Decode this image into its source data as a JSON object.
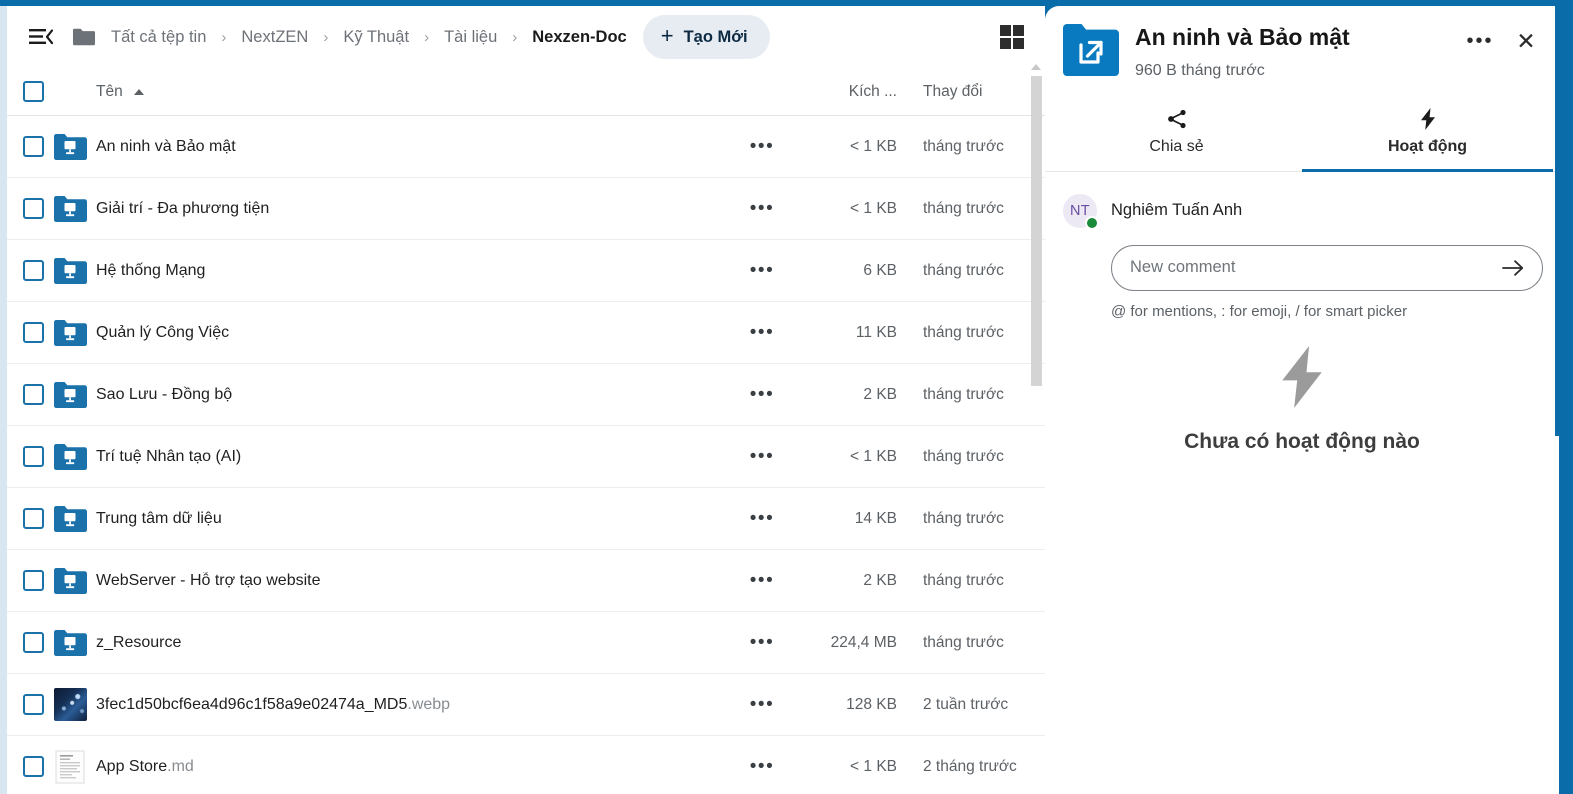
{
  "theme": {
    "accent_blue": "#0a6ca8",
    "folder_blue": "#1b72ab",
    "pill_bg": "#e7ecf2",
    "muted_text": "#5c6166",
    "online_green": "#1a8a3a",
    "avatar_purple": "#6a4fa3"
  },
  "topbar": {
    "menu_icon": "hamburger-collapse-icon",
    "folder_icon": "folder-icon",
    "breadcrumbs": [
      {
        "label": "Tất cả tệp tin",
        "current": false
      },
      {
        "label": "NextZEN",
        "current": false
      },
      {
        "label": "Kỹ Thuật",
        "current": false
      },
      {
        "label": "Tài liệu",
        "current": false
      },
      {
        "label": "Nexzen-Doc",
        "current": true
      }
    ],
    "separator": "›",
    "new_button": {
      "label": "Tạo Mới",
      "icon": "plus-icon"
    },
    "view_toggle_icon": "grid-view-icon"
  },
  "table": {
    "select_all_checkbox": "",
    "columns": {
      "name": "Tên",
      "name_sort_icon": "sort-ascending-icon",
      "size": "Kích ...",
      "modified": "Thay đổi"
    },
    "actions_glyph": "•••",
    "rows": [
      {
        "name": "An ninh và Bảo mật",
        "ext": "",
        "icon": "folder-external-icon",
        "size": "< 1 KB",
        "modified": "tháng trước"
      },
      {
        "name": "Giải trí - Đa phương tiện",
        "ext": "",
        "icon": "folder-external-icon",
        "size": "< 1 KB",
        "modified": "tháng trước"
      },
      {
        "name": "Hệ thống Mạng",
        "ext": "",
        "icon": "folder-external-icon",
        "size": "6 KB",
        "modified": "tháng trước"
      },
      {
        "name": "Quản lý Công Việc",
        "ext": "",
        "icon": "folder-external-icon",
        "size": "11 KB",
        "modified": "tháng trước"
      },
      {
        "name": "Sao Lưu - Đồng bộ",
        "ext": "",
        "icon": "folder-external-icon",
        "size": "2 KB",
        "modified": "tháng trước"
      },
      {
        "name": "Trí tuệ Nhân tạo (AI)",
        "ext": "",
        "icon": "folder-external-icon",
        "size": "< 1 KB",
        "modified": "tháng trước"
      },
      {
        "name": "Trung tâm dữ liệu",
        "ext": "",
        "icon": "folder-external-icon",
        "size": "14 KB",
        "modified": "tháng trước"
      },
      {
        "name": "WebServer - Hỗ trợ tạo website",
        "ext": "",
        "icon": "folder-external-icon",
        "size": "2 KB",
        "modified": "tháng trước"
      },
      {
        "name": "z_Resource",
        "ext": "",
        "icon": "folder-external-icon",
        "size": "224,4 MB",
        "modified": "tháng trước"
      },
      {
        "name": "3fec1d50bcf6ea4d96c1f58a9e02474a_MD5",
        "ext": ".webp",
        "icon": "image-thumbnail",
        "size": "128 KB",
        "modified": "2 tuần trước"
      },
      {
        "name": "App Store",
        "ext": ".md",
        "icon": "markdown-file-icon",
        "size": "< 1 KB",
        "modified": "2 tháng trước"
      }
    ]
  },
  "details": {
    "file_icon": "folder-external-link-icon",
    "title": "An ninh và Bảo mật",
    "subtitle": "960 B tháng trước",
    "menu_glyph": "•••",
    "close_glyph": "✕",
    "tabs": [
      {
        "label": "Chia sẻ",
        "icon": "share-icon",
        "active": false
      },
      {
        "label": "Hoạt động",
        "icon": "lightning-bolt-icon",
        "active": true
      }
    ],
    "comment": {
      "avatar_initials": "NT",
      "author": "Nghiêm Tuấn Anh",
      "input_value": "",
      "input_placeholder": "New comment",
      "submit_icon": "arrow-right-icon",
      "hint": "@ for mentions, : for emoji, / for smart picker"
    },
    "empty_state": {
      "icon": "lightning-bolt-icon",
      "text": "Chưa có hoạt động nào"
    }
  }
}
